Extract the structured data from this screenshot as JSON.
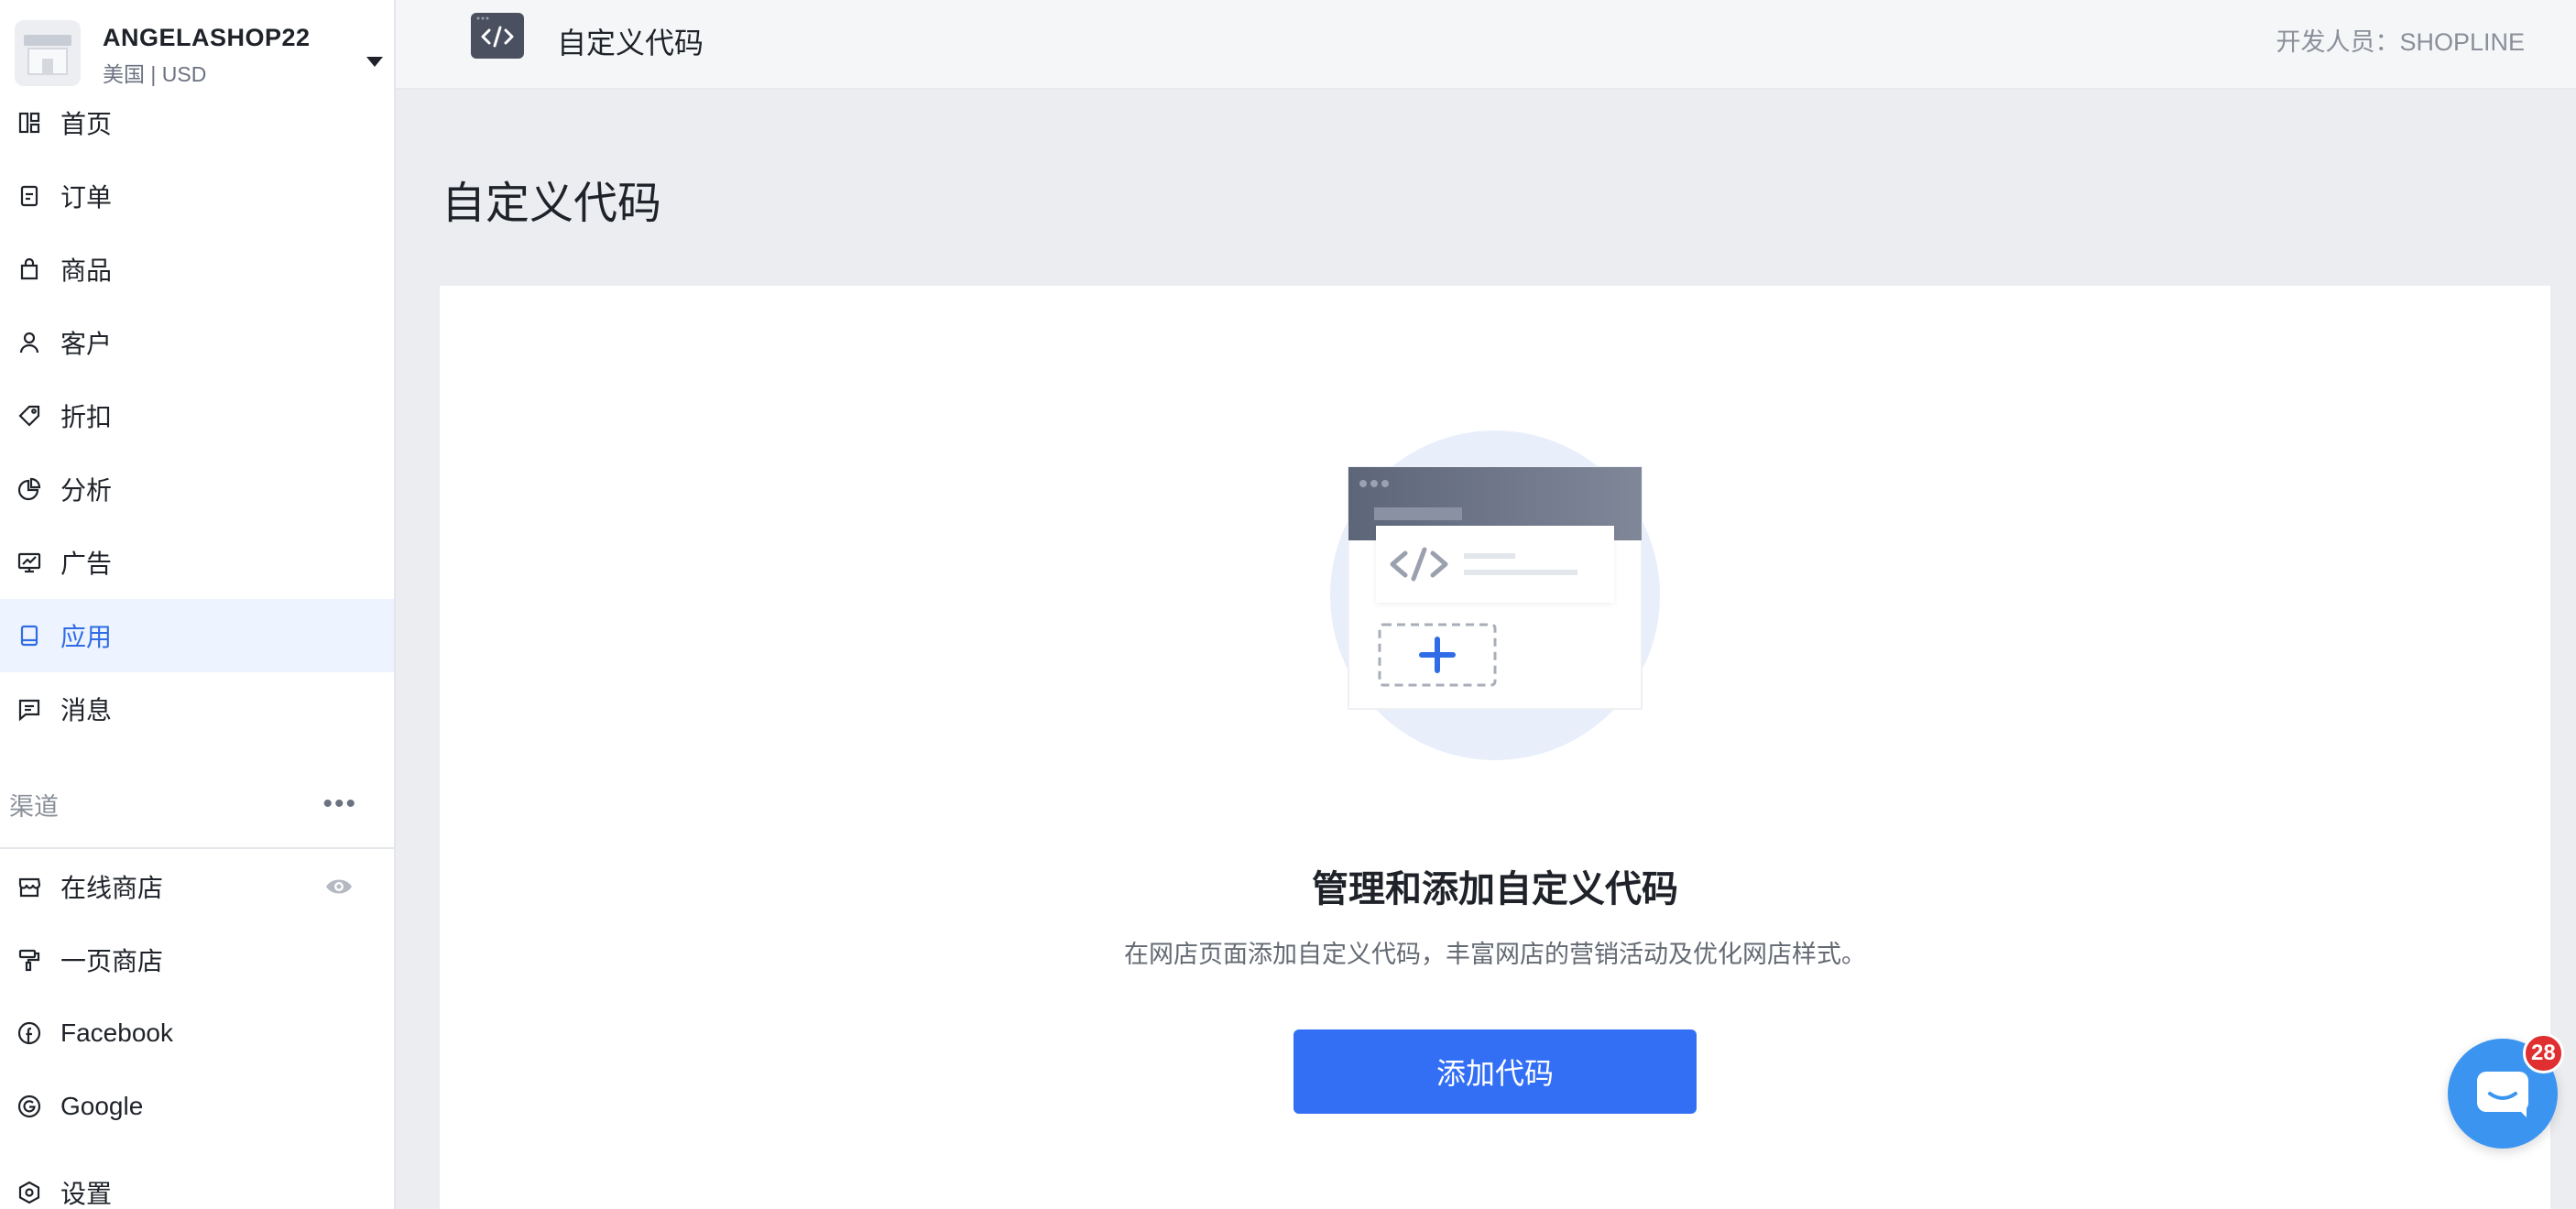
{
  "store": {
    "name": "ANGELASHOP22",
    "subtitle": "美国 | USD"
  },
  "nav": {
    "items": [
      {
        "label": "首页",
        "icon": "dashboard-icon"
      },
      {
        "label": "订单",
        "icon": "order-icon"
      },
      {
        "label": "商品",
        "icon": "bag-icon"
      },
      {
        "label": "客户",
        "icon": "user-icon"
      },
      {
        "label": "折扣",
        "icon": "tag-icon"
      },
      {
        "label": "分析",
        "icon": "pie-chart-icon"
      },
      {
        "label": "广告",
        "icon": "monitor-icon"
      },
      {
        "label": "应用",
        "icon": "app-icon",
        "active": true
      },
      {
        "label": "消息",
        "icon": "message-icon"
      }
    ]
  },
  "channels": {
    "title": "渠道",
    "more": "•••",
    "items": [
      {
        "label": "在线商店",
        "icon": "store-icon"
      },
      {
        "label": "一页商店",
        "icon": "paint-roller-icon"
      },
      {
        "label": "Facebook",
        "icon": "facebook-icon"
      },
      {
        "label": "Google",
        "icon": "google-icon"
      }
    ]
  },
  "settings": {
    "label": "设置",
    "icon": "settings-icon"
  },
  "topbar": {
    "app_title": "自定义代码",
    "developer": "开发人员：SHOPLINE"
  },
  "main": {
    "page_title": "自定义代码",
    "empty_title": "管理和添加自定义代码",
    "empty_desc": "在网店页面添加自定义代码，丰富网店的营销活动及优化网店样式。",
    "add_button": "添加代码"
  },
  "chat": {
    "badge_count": "28"
  },
  "colors": {
    "accent": "#336ff5",
    "active_bg": "#eef4ff",
    "badge": "#e02f31",
    "chat": "#3b95f0"
  }
}
